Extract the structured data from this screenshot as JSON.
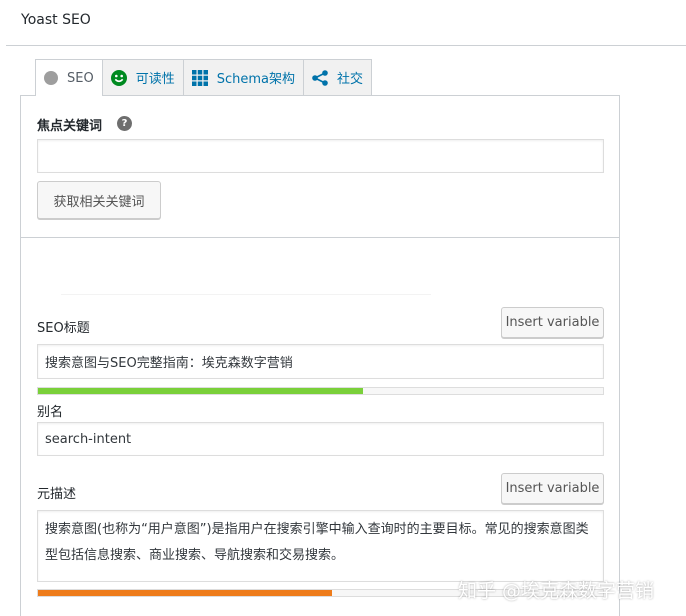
{
  "panel": {
    "title": "Yoast SEO"
  },
  "tabs": [
    {
      "label": "SEO",
      "icon": "circle-gray-icon"
    },
    {
      "label": "可读性",
      "icon": "smiley-green-icon"
    },
    {
      "label": "Schema架构",
      "icon": "grid-icon"
    },
    {
      "label": "社交",
      "icon": "share-icon"
    }
  ],
  "focus_keyword": {
    "label": "焦点关键词",
    "help": "?",
    "value": "",
    "related_button": "获取相关关键词"
  },
  "seo_title": {
    "label": "SEO标题",
    "insert_variable": "Insert variable",
    "value": "搜索意图与SEO完整指南：埃克森数字营销",
    "progress": 0.575,
    "progress_color": "#7ad03a"
  },
  "slug": {
    "label": "别名",
    "value": "search-intent"
  },
  "meta_description": {
    "label": "元描述",
    "insert_variable": "Insert variable",
    "value": "搜索意图(也称为“用户意图”)是指用户在搜索引擎中输入查询时的主要目标。常见的搜索意图类型包括信息搜索、商业搜索、导航搜索和交易搜索。",
    "progress": 0.52,
    "progress_color": "#ee7c1b"
  },
  "watermark": "知乎 @埃克森数字营销",
  "colors": {
    "link": "#0073aa",
    "border": "#ccd0d4",
    "tab_inactive_bg": "#f1f1f1"
  }
}
